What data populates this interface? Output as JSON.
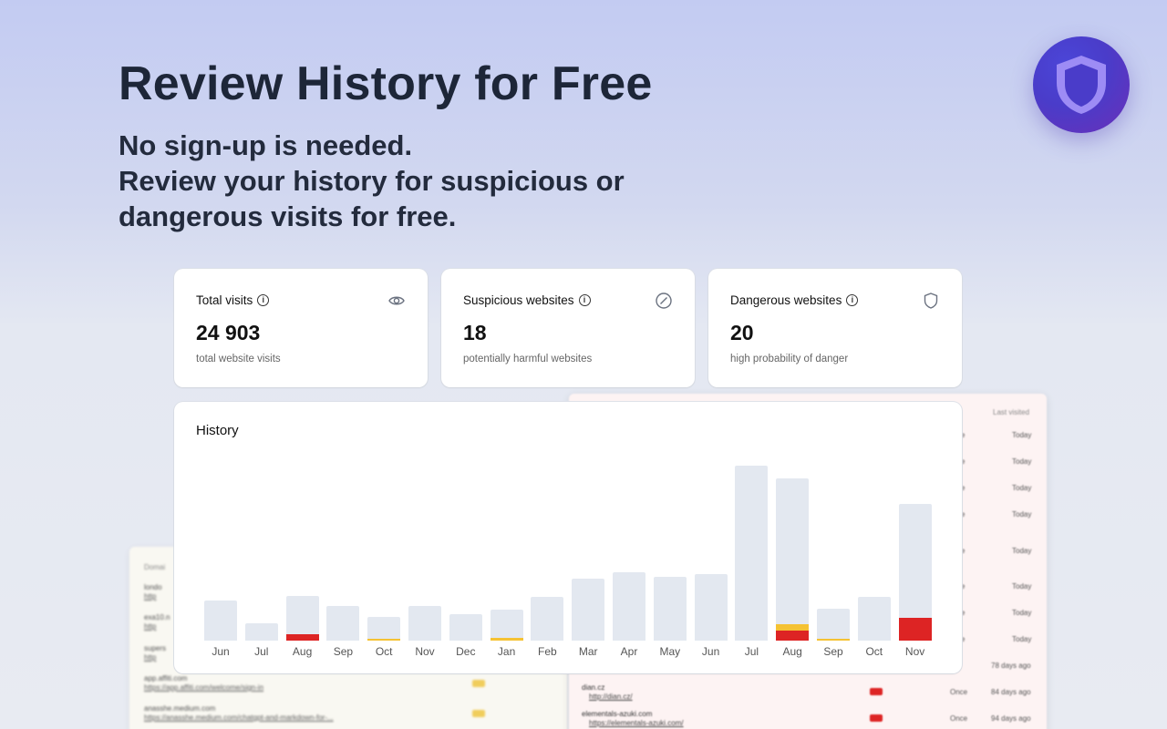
{
  "hero": {
    "title": "Review History for Free",
    "line1": "No sign-up is needed.",
    "line2": "Review your history for suspicious or",
    "line3": "dangerous visits for free."
  },
  "logo": {
    "icon": "shield-icon"
  },
  "stats": [
    {
      "label": "Total visits",
      "value": "24 903",
      "sub": "total website visits",
      "icon": "eye-icon"
    },
    {
      "label": "Suspicious websites",
      "value": "18",
      "sub": "potentially harmful websites",
      "icon": "compass-slash-icon"
    },
    {
      "label": "Dangerous websites",
      "value": "20",
      "sub": "high probability of danger",
      "icon": "shield-outline-icon"
    }
  ],
  "history": {
    "title": "History"
  },
  "chart_data": {
    "type": "bar",
    "categories": [
      "Jun",
      "Jul",
      "Aug",
      "Sep",
      "Oct",
      "Nov",
      "Dec",
      "Jan",
      "Feb",
      "Mar",
      "Apr",
      "May",
      "Jun",
      "Jul",
      "Aug",
      "Sep",
      "Oct",
      "Nov"
    ],
    "series": [
      {
        "values": [
          44,
          19,
          49,
          38,
          26,
          38,
          29,
          34,
          48,
          68,
          75,
          70,
          73,
          192,
          178,
          35,
          48,
          150
        ]
      },
      {
        "values": [
          0,
          0,
          0,
          0,
          2,
          0,
          0,
          3,
          0,
          0,
          0,
          0,
          0,
          0,
          7,
          2,
          0,
          0
        ]
      },
      {
        "values": [
          0,
          0,
          7,
          0,
          0,
          0,
          0,
          0,
          0,
          0,
          0,
          0,
          0,
          0,
          11,
          0,
          0,
          25
        ]
      }
    ],
    "colors": {
      "total": "#e3e8f0",
      "suspicious": "#f5c233",
      "dangerous": "#dd2424"
    },
    "ylim": [
      0,
      200
    ],
    "grid": false
  },
  "background_table_right": {
    "header": "Last visited",
    "rows": [
      {
        "col_a": "e",
        "last": "Today"
      },
      {
        "col_a": "e",
        "last": "Today"
      },
      {
        "col_a": "e",
        "last": "Today"
      },
      {
        "col_a": "e",
        "last": "Today"
      },
      {
        "col_a": "e",
        "last": "Today"
      },
      {
        "col_a": "e",
        "last": "Today"
      },
      {
        "col_a": "e",
        "last": "Today"
      },
      {
        "col_a": "e",
        "last": "Today"
      },
      {
        "col_a": "",
        "last": "78 days ago"
      },
      {
        "domain": "dian.cz",
        "link": "http://dian.cz/",
        "freq": "Once",
        "last": "84 days ago"
      },
      {
        "domain": "elementals-azuki.com",
        "link": "https://elementals-azuki.com/",
        "freq": "Once",
        "last": "94 days ago"
      }
    ]
  },
  "background_table_left": {
    "header": "Domai",
    "rows": [
      {
        "domain": "londo",
        "link": "http"
      },
      {
        "domain": "exa10.n",
        "link": "http"
      },
      {
        "domain": "supers",
        "link": "http"
      },
      {
        "domain": "app.affiti.com",
        "link": "https://app.affiti.com/welcome/sign-in"
      },
      {
        "domain": "anasshe.medium.com",
        "link": "https://anasshe.medium.com/chatgpt-and-markdown-for-..."
      }
    ]
  }
}
